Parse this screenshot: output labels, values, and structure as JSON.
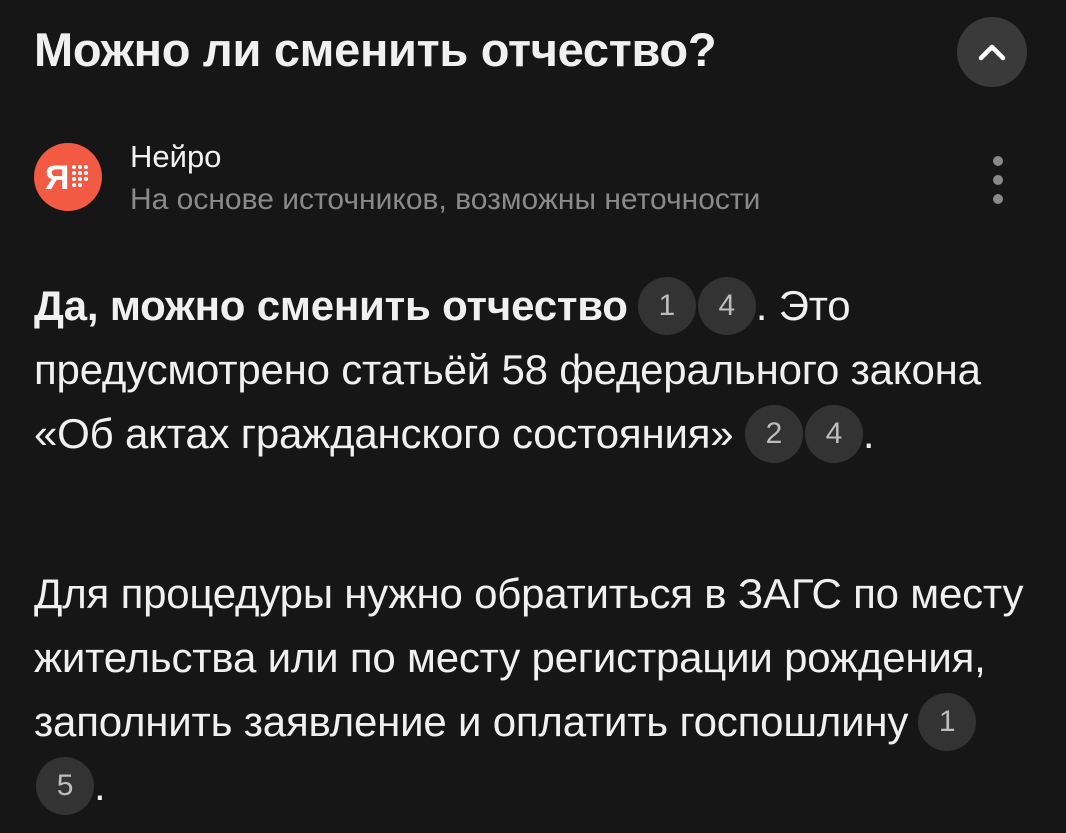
{
  "header": {
    "title": "Можно ли сменить отчество?"
  },
  "source": {
    "name": "Нейро",
    "subtitle": "На основе источников, возможны неточности",
    "avatar_letter": "Я",
    "avatar_color": "#f25a43"
  },
  "answer": {
    "p1_bold": "Да, можно сменить отчество",
    "p1_cites_a": [
      "1",
      "4"
    ],
    "p1_after_a": ". Это предусмотрено статьёй 58 федерального закона «Об актах гражданского состояния»",
    "p1_cites_b": [
      "2",
      "4"
    ],
    "p1_end": ".",
    "p2_text": "Для процедуры нужно обратиться в ЗАГС по месту жительства или по месту регистрации рождения, заполнить заявление и оплатить госпошлину",
    "p2_cites": [
      "1",
      "5"
    ],
    "p2_end": "."
  },
  "icons": {
    "collapse": "chevron-up-icon",
    "more": "more-vertical-icon"
  }
}
